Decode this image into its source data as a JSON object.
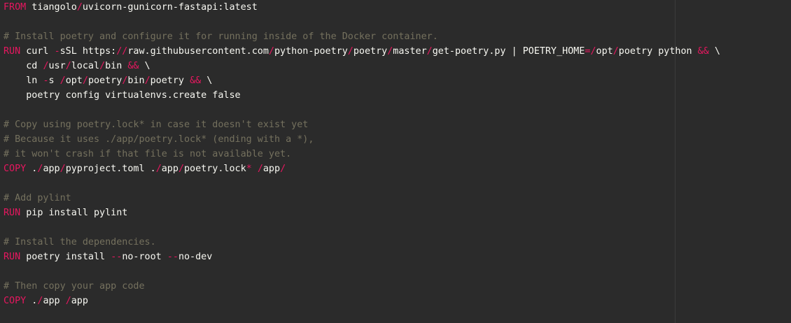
{
  "editor": {
    "language": "Dockerfile",
    "colors": {
      "background": "#2b2b2b",
      "text": "#f8f8f2",
      "keyword": "#e6175f",
      "operator": "#e6175f",
      "comment": "#75715e",
      "margin_guide": "#3c3c3c"
    },
    "lines": [
      [
        {
          "t": "FROM",
          "c": "keyword"
        },
        {
          "t": " tiangolo",
          "c": "text"
        },
        {
          "t": "/",
          "c": "operator"
        },
        {
          "t": "uvicorn-gunicorn-fastapi:latest",
          "c": "text"
        }
      ],
      [],
      [
        {
          "t": "# Install poetry and configure it for running inside of the Docker container.",
          "c": "comment"
        }
      ],
      [
        {
          "t": "RUN",
          "c": "keyword"
        },
        {
          "t": " curl ",
          "c": "text"
        },
        {
          "t": "-",
          "c": "operator"
        },
        {
          "t": "sSL https:",
          "c": "text"
        },
        {
          "t": "//",
          "c": "operator"
        },
        {
          "t": "raw.githubusercontent.com",
          "c": "text"
        },
        {
          "t": "/",
          "c": "operator"
        },
        {
          "t": "python-poetry",
          "c": "text"
        },
        {
          "t": "/",
          "c": "operator"
        },
        {
          "t": "poetry",
          "c": "text"
        },
        {
          "t": "/",
          "c": "operator"
        },
        {
          "t": "master",
          "c": "text"
        },
        {
          "t": "/",
          "c": "operator"
        },
        {
          "t": "get-poetry.py | POETRY_HOME",
          "c": "text"
        },
        {
          "t": "=/",
          "c": "operator"
        },
        {
          "t": "opt",
          "c": "text"
        },
        {
          "t": "/",
          "c": "operator"
        },
        {
          "t": "poetry python ",
          "c": "text"
        },
        {
          "t": "&&",
          "c": "operator"
        },
        {
          "t": " \\",
          "c": "text"
        }
      ],
      [
        {
          "t": "    cd ",
          "c": "text"
        },
        {
          "t": "/",
          "c": "operator"
        },
        {
          "t": "usr",
          "c": "text"
        },
        {
          "t": "/",
          "c": "operator"
        },
        {
          "t": "local",
          "c": "text"
        },
        {
          "t": "/",
          "c": "operator"
        },
        {
          "t": "bin ",
          "c": "text"
        },
        {
          "t": "&&",
          "c": "operator"
        },
        {
          "t": " \\",
          "c": "text"
        }
      ],
      [
        {
          "t": "    ln ",
          "c": "text"
        },
        {
          "t": "-",
          "c": "operator"
        },
        {
          "t": "s ",
          "c": "text"
        },
        {
          "t": "/",
          "c": "operator"
        },
        {
          "t": "opt",
          "c": "text"
        },
        {
          "t": "/",
          "c": "operator"
        },
        {
          "t": "poetry",
          "c": "text"
        },
        {
          "t": "/",
          "c": "operator"
        },
        {
          "t": "bin",
          "c": "text"
        },
        {
          "t": "/",
          "c": "operator"
        },
        {
          "t": "poetry ",
          "c": "text"
        },
        {
          "t": "&&",
          "c": "operator"
        },
        {
          "t": " \\",
          "c": "text"
        }
      ],
      [
        {
          "t": "    poetry config virtualenvs.create false",
          "c": "text"
        }
      ],
      [],
      [
        {
          "t": "# Copy using poetry.lock* in case it doesn't exist yet",
          "c": "comment"
        }
      ],
      [
        {
          "t": "# Because it uses ./app/poetry.lock* (ending with a *),",
          "c": "comment"
        }
      ],
      [
        {
          "t": "# it won't crash if that file is not available yet.",
          "c": "comment"
        }
      ],
      [
        {
          "t": "COPY",
          "c": "keyword"
        },
        {
          "t": " .",
          "c": "text"
        },
        {
          "t": "/",
          "c": "operator"
        },
        {
          "t": "app",
          "c": "text"
        },
        {
          "t": "/",
          "c": "operator"
        },
        {
          "t": "pyproject.toml .",
          "c": "text"
        },
        {
          "t": "/",
          "c": "operator"
        },
        {
          "t": "app",
          "c": "text"
        },
        {
          "t": "/",
          "c": "operator"
        },
        {
          "t": "poetry.lock",
          "c": "text"
        },
        {
          "t": "*",
          "c": "operator"
        },
        {
          "t": " ",
          "c": "text"
        },
        {
          "t": "/",
          "c": "operator"
        },
        {
          "t": "app",
          "c": "text"
        },
        {
          "t": "/",
          "c": "operator"
        }
      ],
      [],
      [
        {
          "t": "# Add pylint",
          "c": "comment"
        }
      ],
      [
        {
          "t": "RUN",
          "c": "keyword"
        },
        {
          "t": " pip install pylint",
          "c": "text"
        }
      ],
      [],
      [
        {
          "t": "# Install the dependencies.",
          "c": "comment"
        }
      ],
      [
        {
          "t": "RUN",
          "c": "keyword"
        },
        {
          "t": " poetry install ",
          "c": "text"
        },
        {
          "t": "--",
          "c": "operator"
        },
        {
          "t": "no-root ",
          "c": "text"
        },
        {
          "t": "--",
          "c": "operator"
        },
        {
          "t": "no-dev",
          "c": "text"
        }
      ],
      [],
      [
        {
          "t": "# Then copy your app code",
          "c": "comment"
        }
      ],
      [
        {
          "t": "COPY",
          "c": "keyword"
        },
        {
          "t": " .",
          "c": "text"
        },
        {
          "t": "/",
          "c": "operator"
        },
        {
          "t": "app ",
          "c": "text"
        },
        {
          "t": "/",
          "c": "operator"
        },
        {
          "t": "app",
          "c": "text"
        }
      ]
    ]
  }
}
